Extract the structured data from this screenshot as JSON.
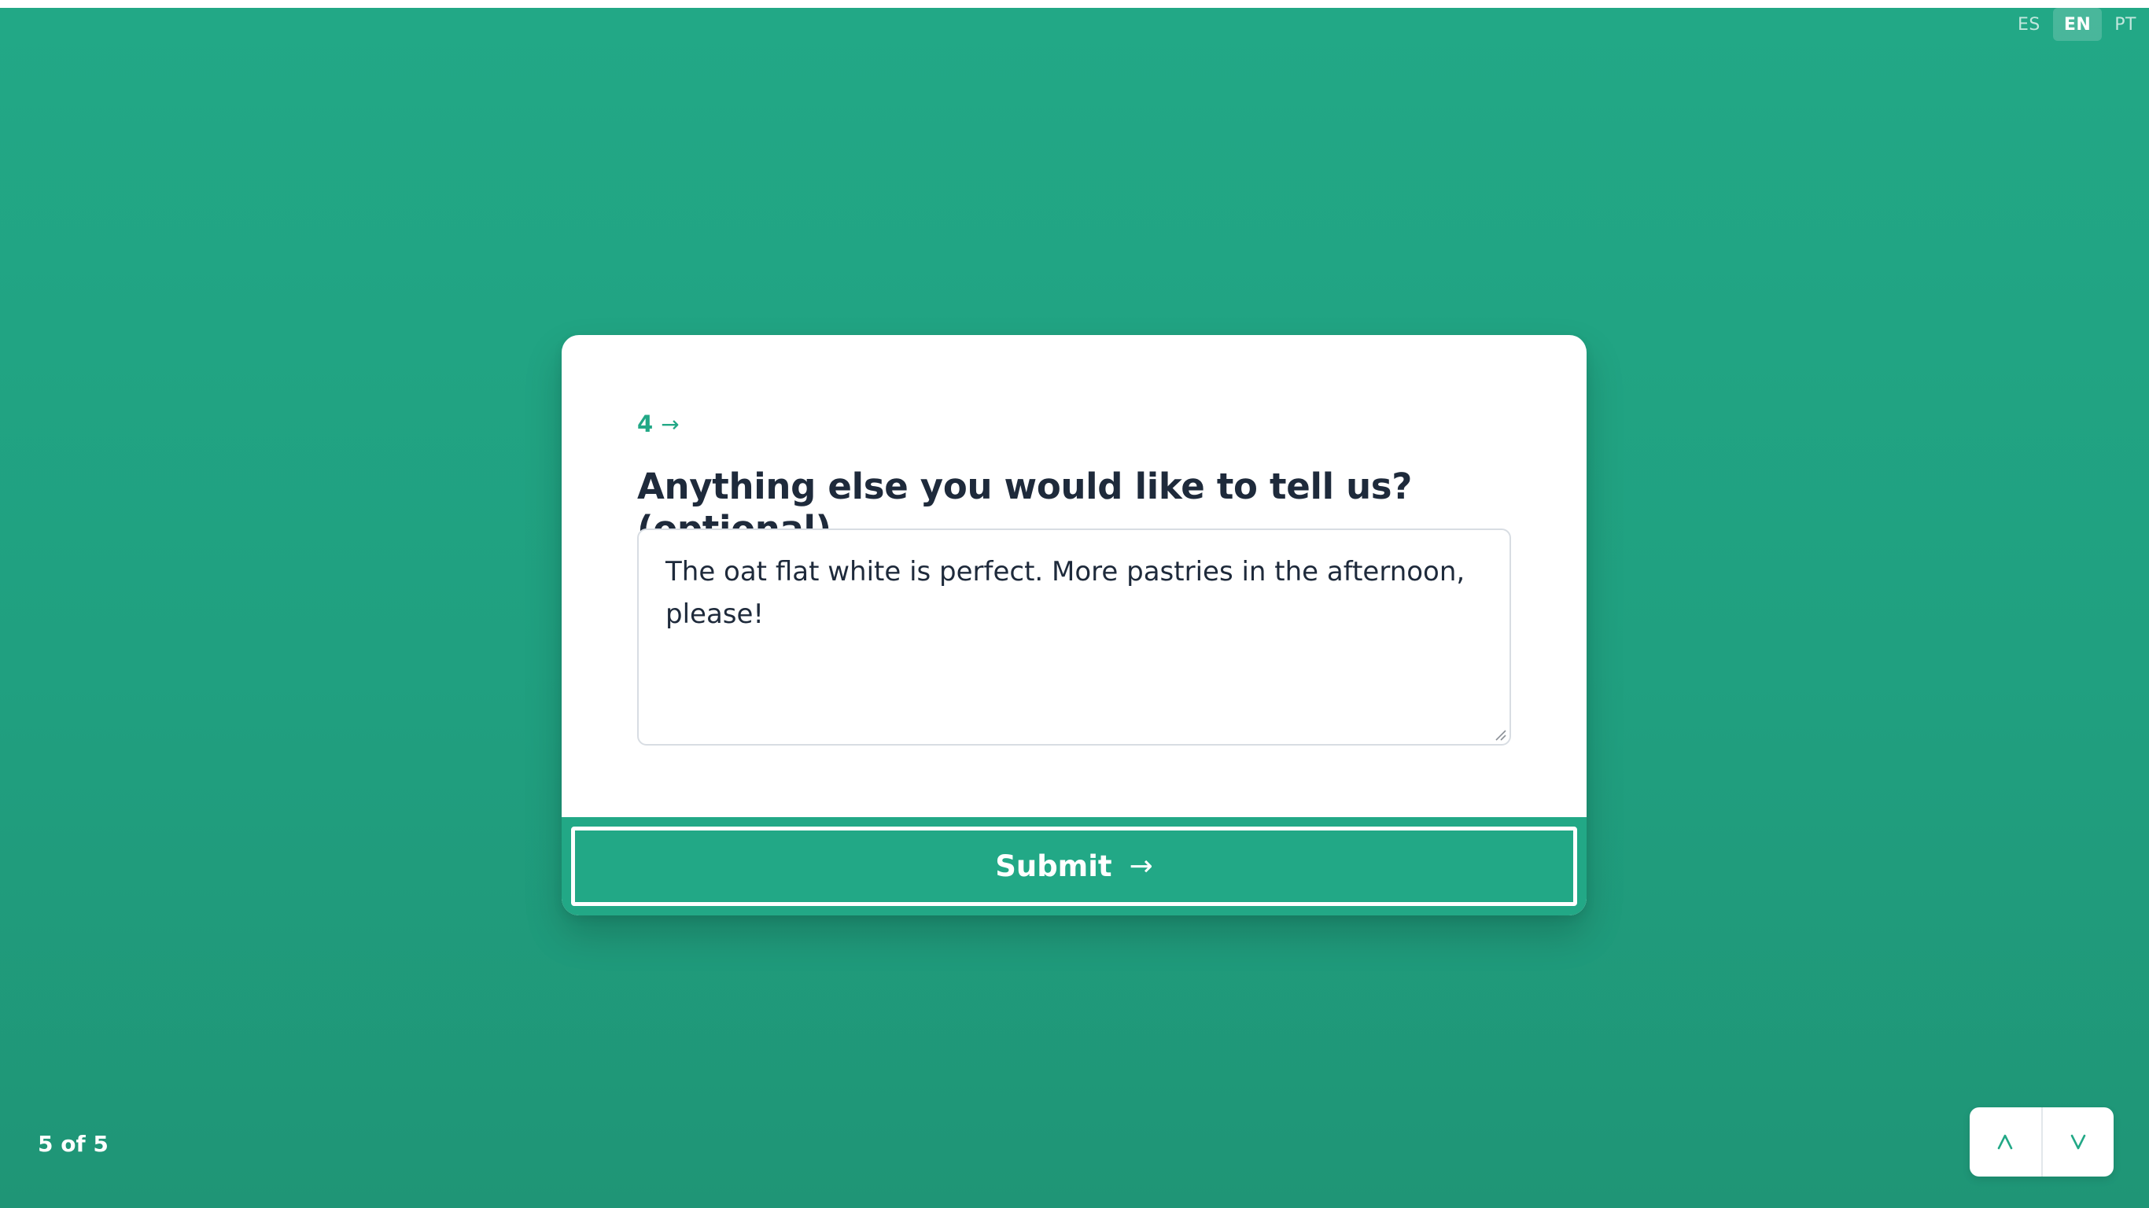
{
  "languages": {
    "items": [
      {
        "code": "ES"
      },
      {
        "code": "EN",
        "active": true
      },
      {
        "code": "PT"
      }
    ]
  },
  "question": {
    "number": "4",
    "arrow": "→",
    "title": "Anything else you would like to tell us? (optional)",
    "answer": "The oat flat white is perfect. More pastries in the afternoon, please!"
  },
  "submit": {
    "label": "Submit",
    "arrow": "→"
  },
  "progress": {
    "text": "5 of 5"
  },
  "navigation": {
    "up_icon": "chevron-up-icon",
    "down_icon": "chevron-down-icon"
  },
  "colors": {
    "accent": "#22a886",
    "title_text": "#1e2a3b",
    "card_background": "#ffffff"
  }
}
